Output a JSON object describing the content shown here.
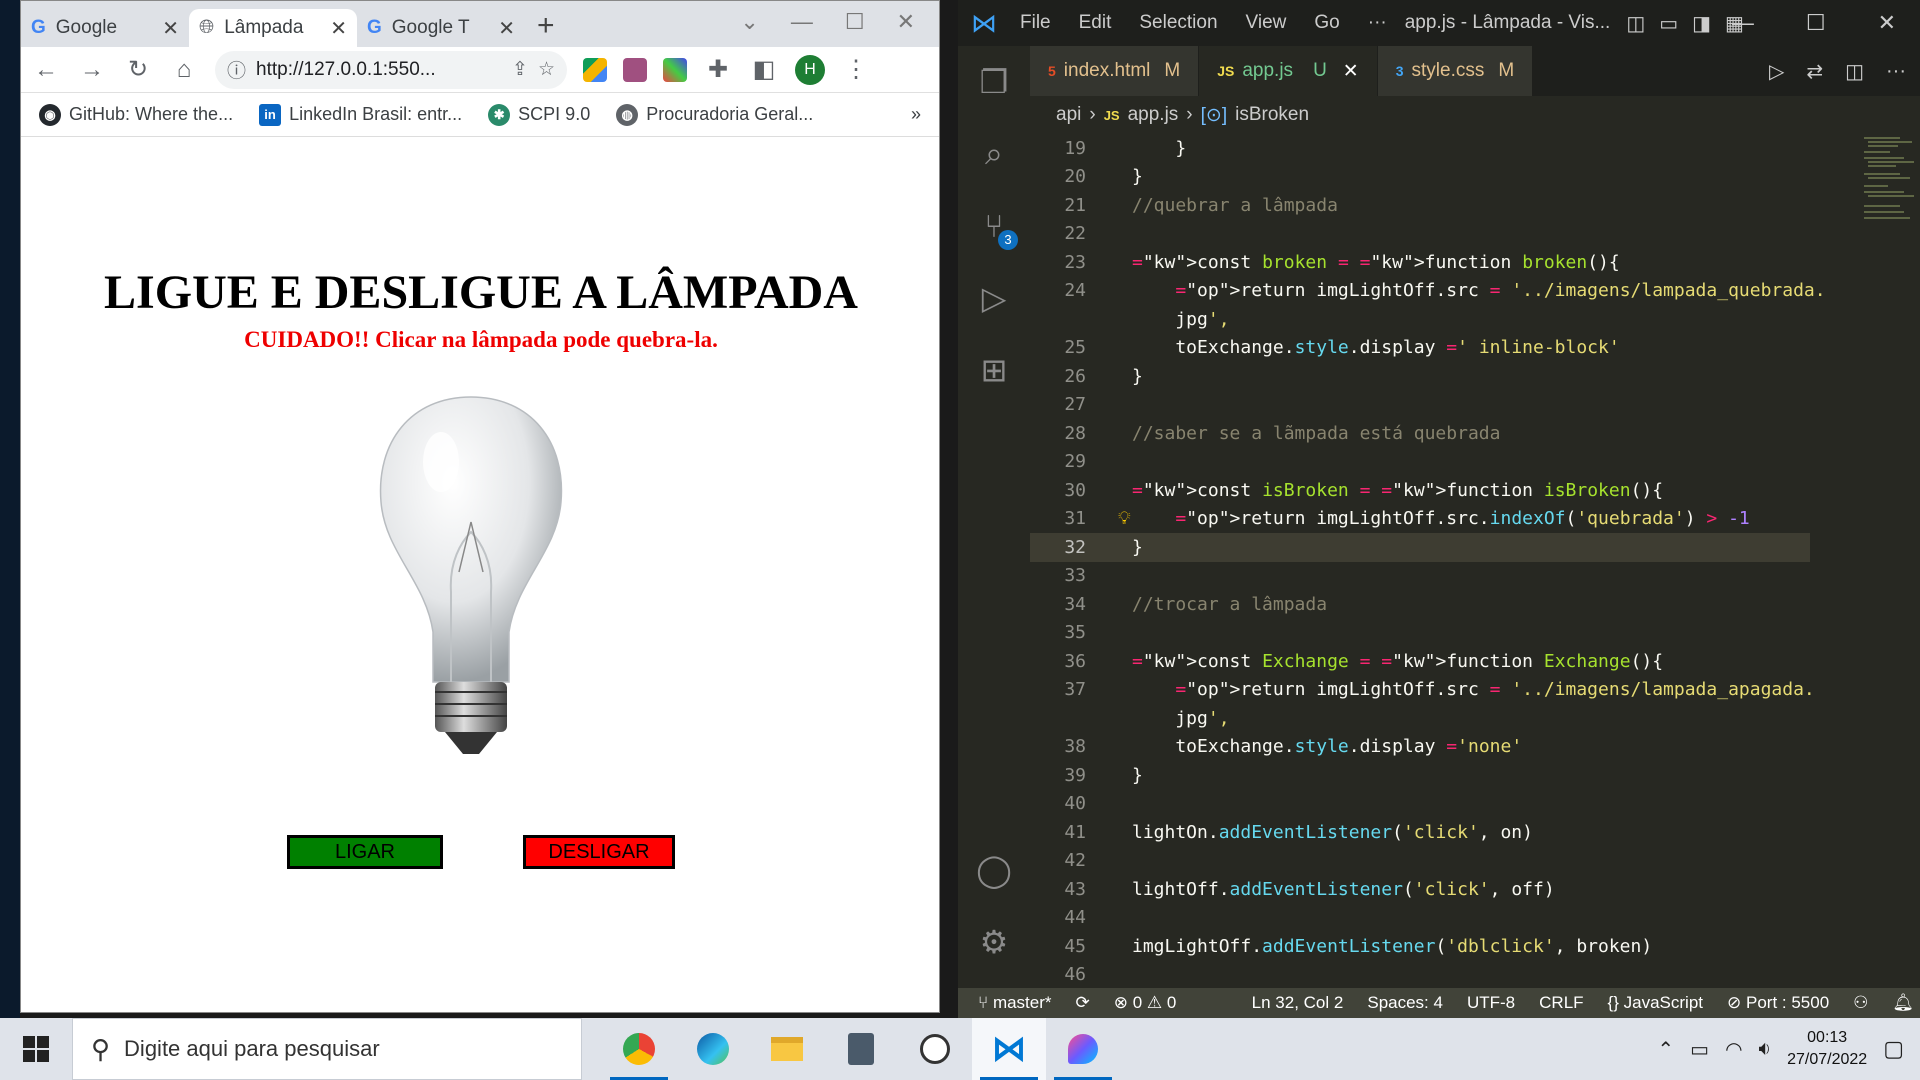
{
  "browser": {
    "tabs": [
      {
        "label": "Google",
        "icon": "google-icon"
      },
      {
        "label": "Lâmpada",
        "icon": "globe-icon"
      },
      {
        "label": "Google T",
        "icon": "google-translate-icon"
      }
    ],
    "url": "http://127.0.0.1:550...",
    "profile_initial": "H",
    "bookmarks": [
      {
        "label": "GitHub: Where the...",
        "icon": "github-icon"
      },
      {
        "label": "LinkedIn Brasil: entr...",
        "icon": "linkedin-icon"
      },
      {
        "label": "SCPI 9.0",
        "icon": "scpi-icon"
      },
      {
        "label": "Procuradoria Geral...",
        "icon": "globe-icon"
      }
    ],
    "bookmarks_more": "»"
  },
  "page": {
    "title": "LIGUE E DESLIGUE A LÂMPADA",
    "warning": "CUIDADO!! Clicar na lâmpada pode quebra-la.",
    "on_button": "LIGAR",
    "off_button": "DESLIGAR"
  },
  "vscode": {
    "menu": [
      "File",
      "Edit",
      "Selection",
      "View",
      "Go",
      "···"
    ],
    "window_title": "app.js - Lâmpada - Vis...",
    "tabs": [
      {
        "label": "index.html",
        "status": "M",
        "icon": "html-file-icon"
      },
      {
        "label": "app.js",
        "status": "U",
        "icon": "js-file-icon"
      },
      {
        "label": "style.css",
        "status": "M",
        "icon": "css-file-icon"
      }
    ],
    "breadcrumb": [
      "api",
      "app.js",
      "isBroken"
    ],
    "source_control_badge": "3",
    "status": {
      "branch": "master*",
      "errors": "0",
      "warnings": "0",
      "position": "Ln 32, Col 2",
      "spaces": "Spaces: 4",
      "encoding": "UTF-8",
      "eol": "CRLF",
      "language": "JavaScript",
      "port": "Port : 5500"
    }
  },
  "code_lines": [
    {
      "n": "19",
      "text": "    }"
    },
    {
      "n": "20",
      "text": "}"
    },
    {
      "n": "21",
      "text": "//quebrar a lâmpada"
    },
    {
      "n": "22",
      "text": ""
    },
    {
      "n": "23",
      "text": "const broken = function broken(){"
    },
    {
      "n": "24",
      "text": "    return imgLightOff.src = '../imagens/lampada_quebrada."
    },
    {
      "n": "",
      "text": "    jpg',"
    },
    {
      "n": "25",
      "text": "    toExchange.style.display =' inline-block'"
    },
    {
      "n": "26",
      "text": "}"
    },
    {
      "n": "27",
      "text": ""
    },
    {
      "n": "28",
      "text": "//saber se a lãmpada está quebrada"
    },
    {
      "n": "29",
      "text": ""
    },
    {
      "n": "30",
      "text": "const isBroken = function isBroken(){"
    },
    {
      "n": "31",
      "text": "    return imgLightOff.src.indexOf('quebrada') > -1"
    },
    {
      "n": "32",
      "text": "}"
    },
    {
      "n": "33",
      "text": ""
    },
    {
      "n": "34",
      "text": "//trocar a lâmpada"
    },
    {
      "n": "35",
      "text": ""
    },
    {
      "n": "36",
      "text": "const Exchange = function Exchange(){"
    },
    {
      "n": "37",
      "text": "    return imgLightOff.src = '../imagens/lampada_apagada."
    },
    {
      "n": "",
      "text": "    jpg',"
    },
    {
      "n": "38",
      "text": "    toExchange.style.display ='none'"
    },
    {
      "n": "39",
      "text": "}"
    },
    {
      "n": "40",
      "text": ""
    },
    {
      "n": "41",
      "text": "lightOn.addEventListener('click', on)"
    },
    {
      "n": "42",
      "text": ""
    },
    {
      "n": "43",
      "text": "lightOff.addEventListener('click', off)"
    },
    {
      "n": "44",
      "text": ""
    },
    {
      "n": "45",
      "text": "imgLightOff.addEventListener('dblclick', broken)"
    },
    {
      "n": "46",
      "text": ""
    }
  ],
  "taskbar": {
    "search_placeholder": "Digite aqui para pesquisar",
    "time": "00:13",
    "date": "27/07/2022"
  },
  "colors": {
    "on_button": "#008000",
    "off_button": "#ff0000",
    "warning_text": "#ee0000",
    "vscode_bg": "#272822"
  }
}
